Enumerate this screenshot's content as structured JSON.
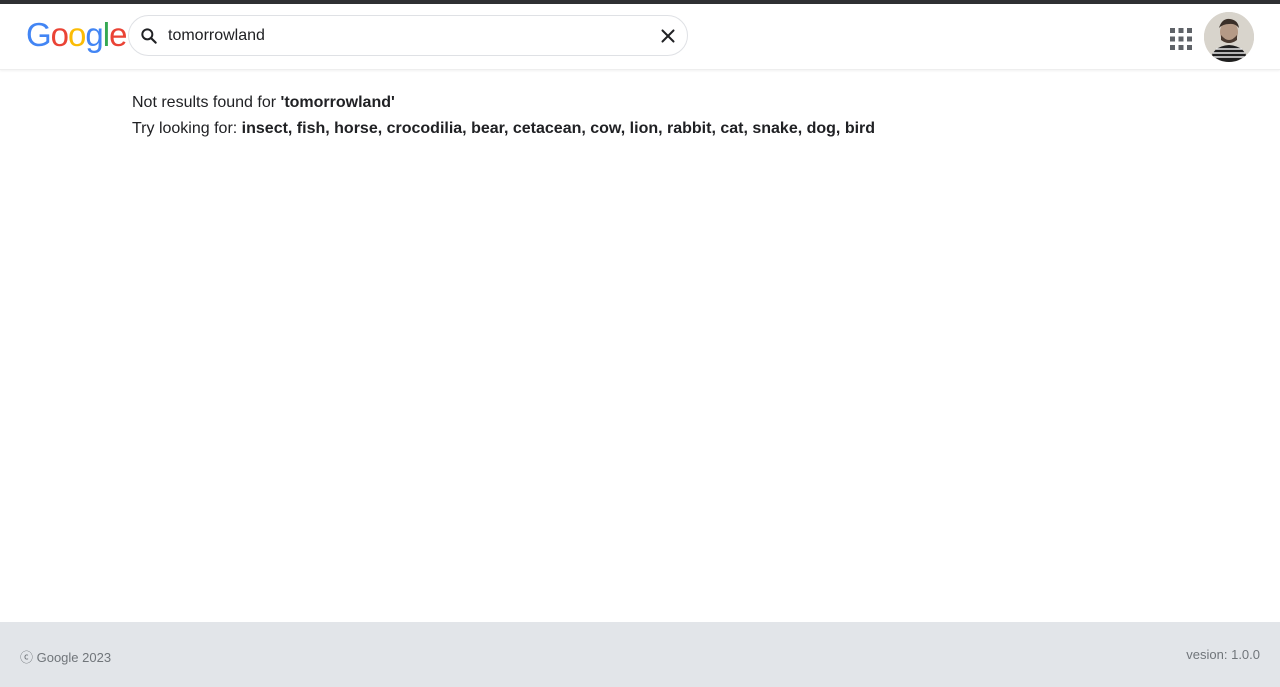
{
  "header": {
    "logo": {
      "letters": [
        "G",
        "o",
        "o",
        "g",
        "l",
        "e"
      ],
      "colors": [
        "#4285F4",
        "#EA4335",
        "#FBBC05",
        "#4285F4",
        "#34A853",
        "#EA4335"
      ]
    },
    "search": {
      "value": "tomorrowland",
      "search_icon": "search-icon",
      "clear_icon": "close-icon"
    },
    "apps_icon": "apps-grid-icon",
    "avatar_icon": "user-avatar"
  },
  "main": {
    "no_results_prefix": "Not results found for ",
    "no_results_query": "'tomorrowland'",
    "suggest_prefix": "Try looking for: ",
    "suggestions": "insect, fish, horse, crocodilia, bear, cetacean, cow, lion, rabbit, cat, snake, dog, bird"
  },
  "footer": {
    "copyright": "ⓒ Google 2023",
    "version": "vesion: 1.0.0"
  },
  "colors": {
    "top_strip": "#2f3033",
    "footer_bg": "#e2e5e9",
    "text": "#202124",
    "muted": "#70757a"
  }
}
